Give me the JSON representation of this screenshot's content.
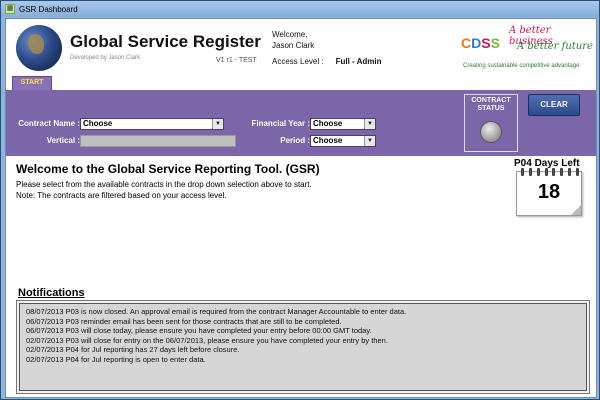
{
  "window": {
    "title": "GSR Dashboard"
  },
  "header": {
    "app_title": "Global Service Register",
    "developer_note": "Developed by Jason Clark",
    "version": "V1 r1 - TEST",
    "welcome_line": "Welcome,",
    "user_name": "Jason Clark",
    "access_label": "Access Level :",
    "access_value": "Full - Admin",
    "logo": {
      "letters": [
        "C",
        "D",
        "S",
        "S"
      ],
      "tagline_top": "A better business",
      "tagline_bottom": "A better future",
      "subtitle": "Creating sustainable competitive advantage"
    }
  },
  "tabs": {
    "start_label": "START"
  },
  "filters": {
    "contract_name_label": "Contract Name :",
    "contract_name_value": "Choose",
    "vertical_label": "Vertical :",
    "vertical_value": "",
    "financial_year_label": "Financial Year :",
    "financial_year_value": "Choose",
    "period_label": "Period :",
    "period_value": "Choose",
    "contract_status_label": "CONTRACT STATUS",
    "clear_label": "CLEAR"
  },
  "main": {
    "heading": "Welcome to the Global Service Reporting Tool. (GSR)",
    "intro_line_1": "Please select from the available contracts in the drop down selection above to start.",
    "intro_line_2": "Note: The contracts are filtered based on your access level.",
    "days_left_title": "P04 Days Left",
    "days_left_value": "18"
  },
  "notifications": {
    "heading": "Notifications",
    "items": [
      "08/07/2013 P03 is now closed.  An approval email is required from the contract Manager Accountable to enter data.",
      "06/07/2013 P03 reminder email has been sent for those contracts that are still to be completed.",
      "06/07/2013 P03 will close today, please ensure you have completed your entry before 00:00 GMT today.",
      "02/07/2013 P03 will close for entry on the 06/07/2013, please ensure you have completed your entry by then.",
      "02/07/2013 P04 for Jul reporting has 27 days left before closure.",
      "02/07/2013 P04 for Jul reporting is open to enter data."
    ]
  }
}
